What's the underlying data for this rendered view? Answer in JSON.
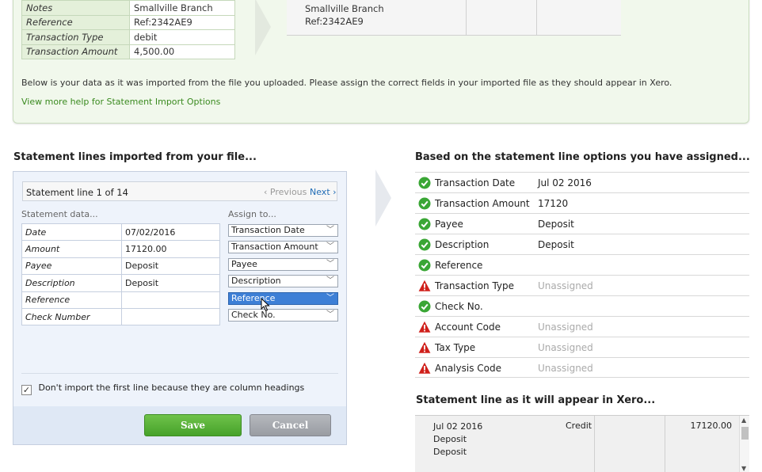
{
  "top_panel": {
    "sample_rows": [
      {
        "label": "Notes",
        "value": "Smallville Branch"
      },
      {
        "label": "Reference",
        "value": "Ref:2342AE9"
      },
      {
        "label": "Transaction Type",
        "value": "debit"
      },
      {
        "label": "Transaction Amount",
        "value": "4,500.00"
      }
    ],
    "preview_lines": [
      "Smallville Branch",
      "Ref:2342AE9"
    ],
    "info_text": "Below is your data as it was imported from the file you uploaded. Please assign the correct fields in your imported file as they should appear in Xero.",
    "help_link": "View more help for Statement Import Options"
  },
  "left": {
    "heading": "Statement lines imported from your file...",
    "line_title": "Statement line 1 of 14",
    "prev_label": "‹ Previous",
    "next_label": "Next ›",
    "statement_data_label": "Statement data...",
    "assign_to_label": "Assign to...",
    "rows": [
      {
        "field": "Date",
        "value": "07/02/2016",
        "assign": "Transaction Date"
      },
      {
        "field": "Amount",
        "value": "17120.00",
        "assign": "Transaction Amount"
      },
      {
        "field": "Payee",
        "value": "Deposit",
        "assign": "Payee"
      },
      {
        "field": "Description",
        "value": "Deposit",
        "assign": "Description"
      },
      {
        "field": "Reference",
        "value": "",
        "assign": "Reference"
      },
      {
        "field": "Check Number",
        "value": "",
        "assign": "Check No."
      }
    ],
    "checkbox_label": "Don't import the first line because they are column headings",
    "checkbox_checked": true,
    "save_label": "Save",
    "cancel_label": "Cancel"
  },
  "right": {
    "heading": "Based on the statement line options you have assigned...",
    "results": [
      {
        "status": "ok",
        "field": "Transaction Date",
        "value": "Jul 02 2016"
      },
      {
        "status": "ok",
        "field": "Transaction Amount",
        "value": "17120"
      },
      {
        "status": "ok",
        "field": "Payee",
        "value": "Deposit"
      },
      {
        "status": "ok",
        "field": "Description",
        "value": "Deposit"
      },
      {
        "status": "ok",
        "field": "Reference",
        "value": ""
      },
      {
        "status": "warn",
        "field": "Transaction Type",
        "value": "Unassigned"
      },
      {
        "status": "ok",
        "field": "Check No.",
        "value": ""
      },
      {
        "status": "warn",
        "field": "Account Code",
        "value": "Unassigned"
      },
      {
        "status": "warn",
        "field": "Tax Type",
        "value": "Unassigned"
      },
      {
        "status": "warn",
        "field": "Analysis Code",
        "value": "Unassigned"
      }
    ],
    "preview_heading": "Statement line as it will appear in Xero...",
    "preview": {
      "date": "Jul 02 2016",
      "payee": "Deposit",
      "description": "Deposit",
      "type": "Credit",
      "amount": "17120.00"
    }
  },
  "colors": {
    "ok": "#3aa635",
    "warn": "#d0201b",
    "link_green": "#3a8a1f",
    "save_green": "#46a22a",
    "select_active": "#3d7fd6"
  }
}
